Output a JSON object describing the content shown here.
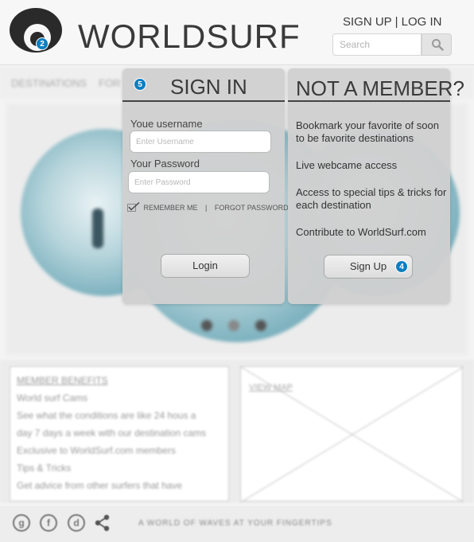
{
  "header": {
    "brand": "WORLDSURF",
    "sign_up": "SIGN UP",
    "separator": "|",
    "log_in": "LOG IN",
    "search_placeholder": "Search"
  },
  "badges": {
    "logo": "2",
    "signin": "5",
    "signup": "4"
  },
  "nav": {
    "items": [
      "DESTINATIONS",
      "FOR"
    ]
  },
  "signin_panel": {
    "title": "SIGN IN",
    "username_label": "Youe username",
    "username_placeholder": "Enter Username",
    "password_label": "Your Password",
    "password_placeholder": "Enter Password",
    "remember_me": "REMEMBER ME",
    "divider": "|",
    "forgot_password": "FORGOT PASSWORD",
    "login_button": "Login"
  },
  "member_panel": {
    "title": "NOT A MEMBER?",
    "benefits": [
      "Bookmark your favorite of soon to be favorite destinations",
      "Live webcame access",
      "Access to special tips & tricks for each destination",
      "Contribute to WorldSurf.com"
    ],
    "signup_button": "Sign Up"
  },
  "lower": {
    "benefits_lines": [
      "MEMBER BENEFITS",
      "World surf Cams",
      "See what the conditions are like 24 hous a",
      "day 7 days a week with our destination cams",
      "Exclusive to WorldSurf.com members",
      "Tips & Tricks",
      "Get advice from other surfers that have"
    ],
    "map_label": "VIEW MAP"
  },
  "footer": {
    "tagline": "A WORLD OF WAVES AT YOUR FINGERTIPS"
  },
  "colors": {
    "badge": "#0d7ec1",
    "panel_bg": "#d0d0d0",
    "text_dark": "#3a3a3a"
  }
}
